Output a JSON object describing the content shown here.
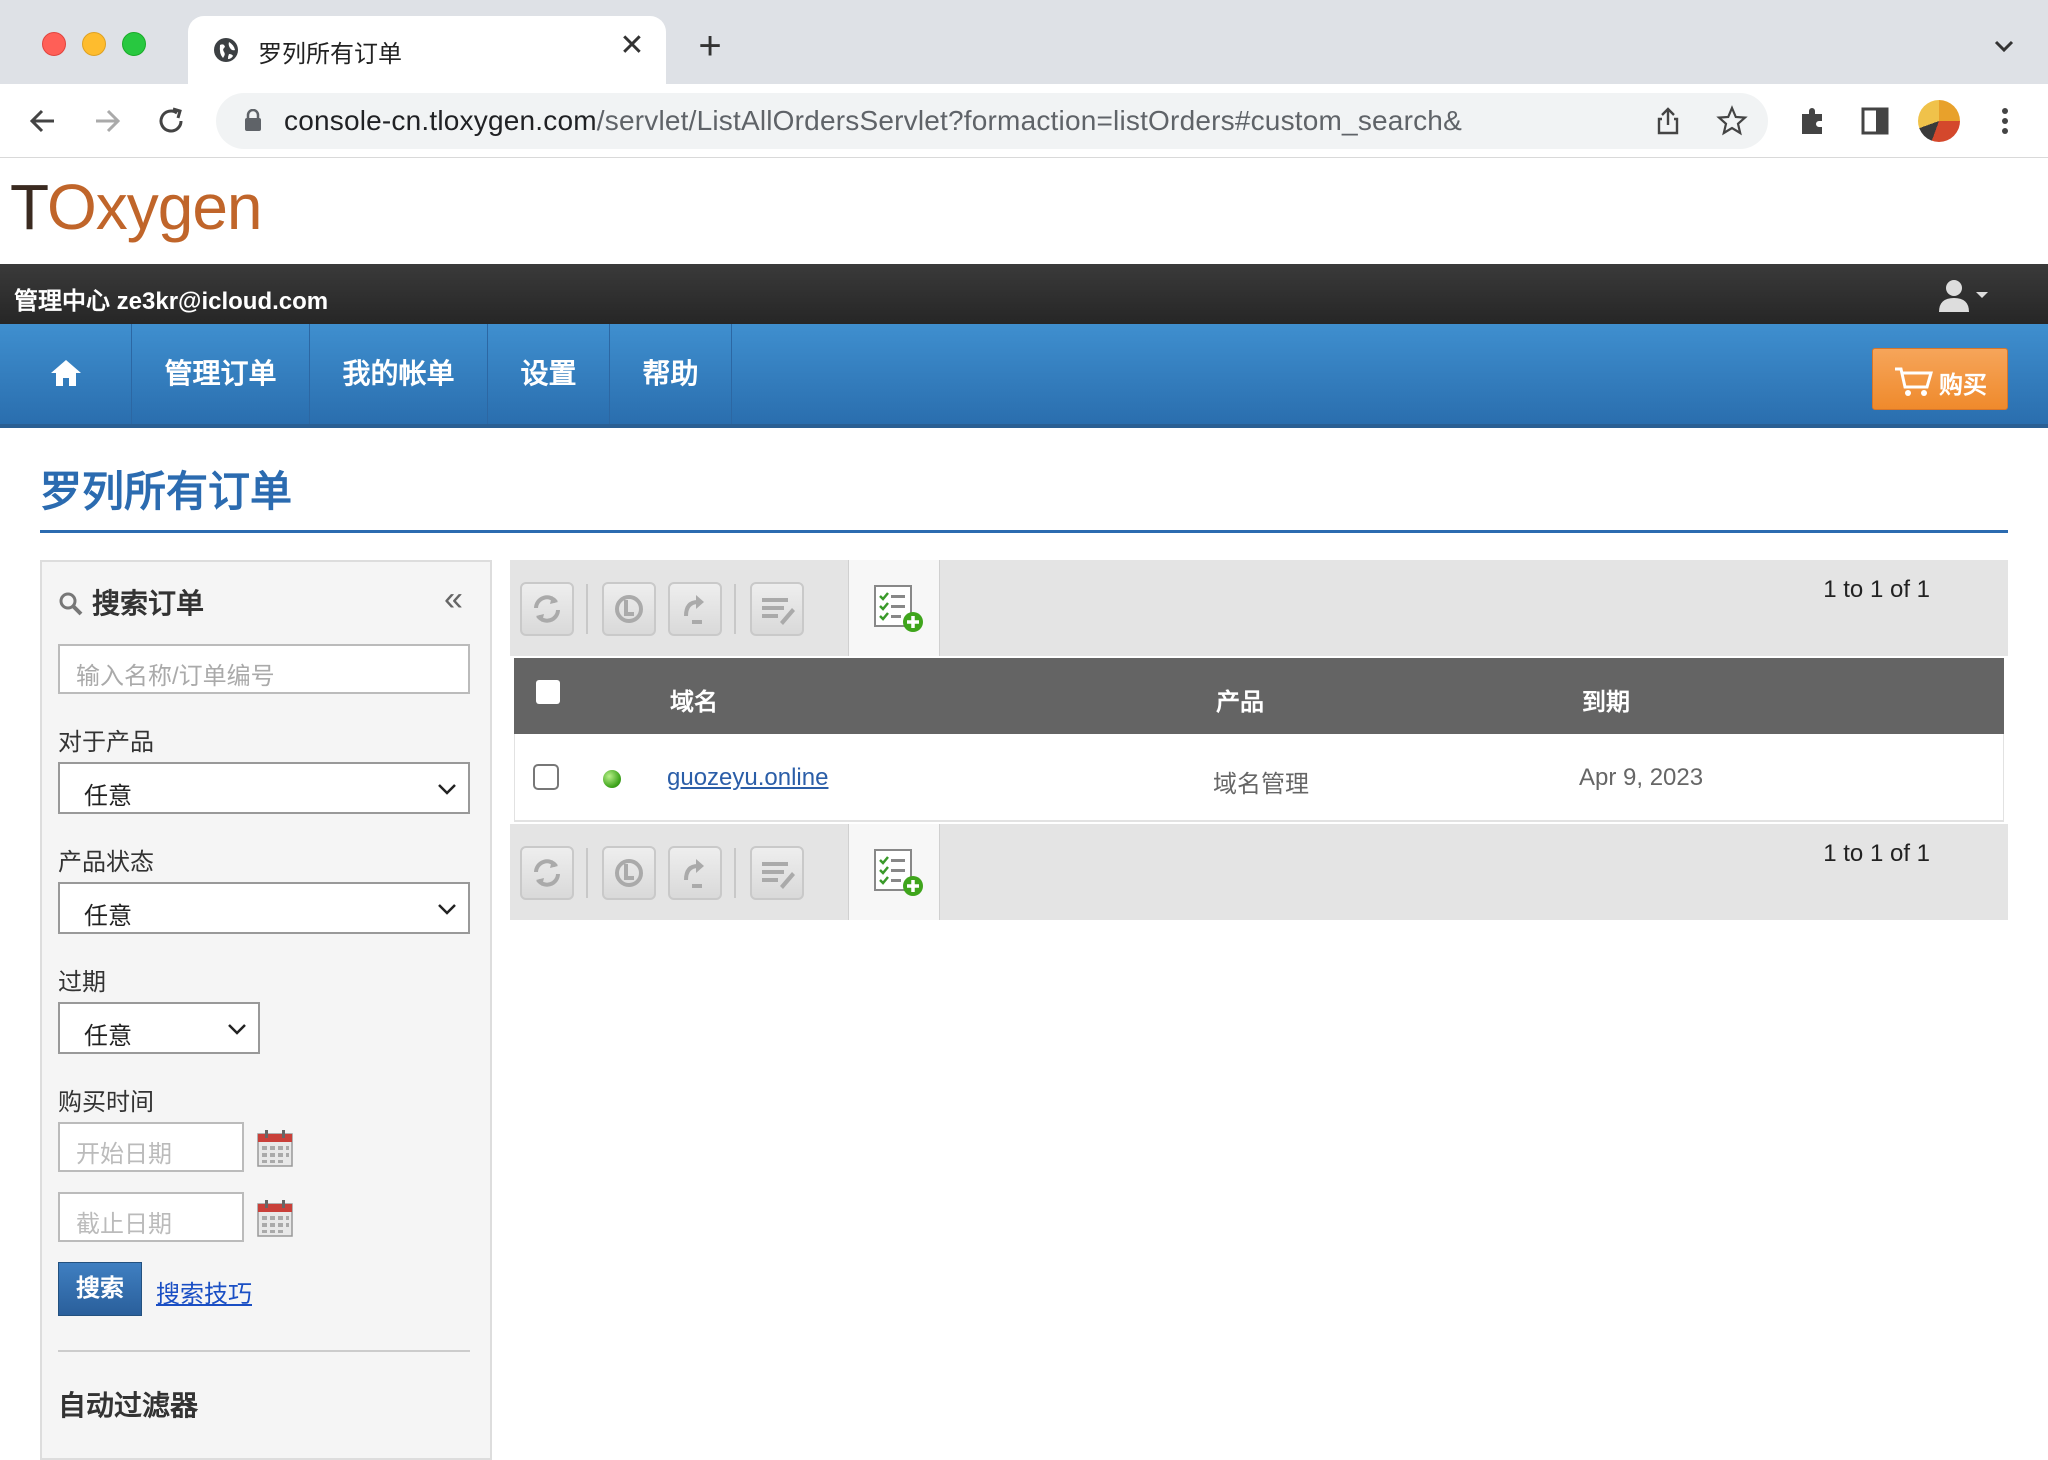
{
  "browser": {
    "tab_title": "罗列所有订单",
    "url_host": "console-cn.tloxygen.com",
    "url_path": "/servlet/ListAllOrdersServlet?formaction=listOrders#custom_search&"
  },
  "site": {
    "logo": {
      "t": "T",
      "rest": "Oxygen"
    },
    "topbar_text": "管理中心 ze3kr@icloud.com",
    "nav": {
      "items": [
        {
          "label": "管理订单"
        },
        {
          "label": "我的帐单"
        },
        {
          "label": "设置"
        },
        {
          "label": "帮助"
        }
      ],
      "buy_label": "购买"
    }
  },
  "page": {
    "title": "罗列所有订单"
  },
  "sidebar": {
    "heading": "搜索订单",
    "collapse_glyph": "«",
    "search_placeholder": "输入名称/订单编号",
    "product_label": "对于产品",
    "product_value": "任意",
    "status_label": "产品状态",
    "status_value": "任意",
    "expiry_label": "过期",
    "expiry_value": "任意",
    "purchase_label": "购买时间",
    "start_placeholder": "开始日期",
    "end_placeholder": "截止日期",
    "search_button": "搜索",
    "tips_link": "搜索技巧",
    "auto_filter": "自动过滤器"
  },
  "table": {
    "pager_text": "1 to 1 of 1",
    "columns": [
      "域名",
      "产品",
      "到期"
    ],
    "rows": [
      {
        "domain": "guozeyu.online",
        "product": "域名管理",
        "expiry": "Apr 9, 2023",
        "status": "active"
      }
    ]
  },
  "colors": {
    "nav_blue": "#2a6eae",
    "title_blue": "#2b6bb0",
    "buy_orange": "#ef8a2c",
    "status_green": "#3fa51c"
  }
}
